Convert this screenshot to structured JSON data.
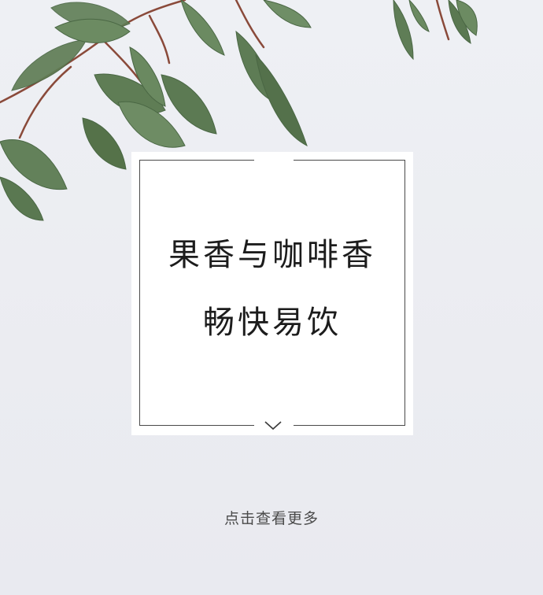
{
  "card": {
    "line1": "果香与咖啡香",
    "line2": "畅快易饮"
  },
  "more_link": {
    "label": "点击查看更多"
  },
  "decoration": {
    "image": "eucalyptus-branch",
    "chevron_icon": "chevron-down-icon"
  },
  "colors": {
    "background": "#ecedf2",
    "leaf": "#5f7d55",
    "stem": "#8a4a3a",
    "text": "#1c1c1c"
  }
}
